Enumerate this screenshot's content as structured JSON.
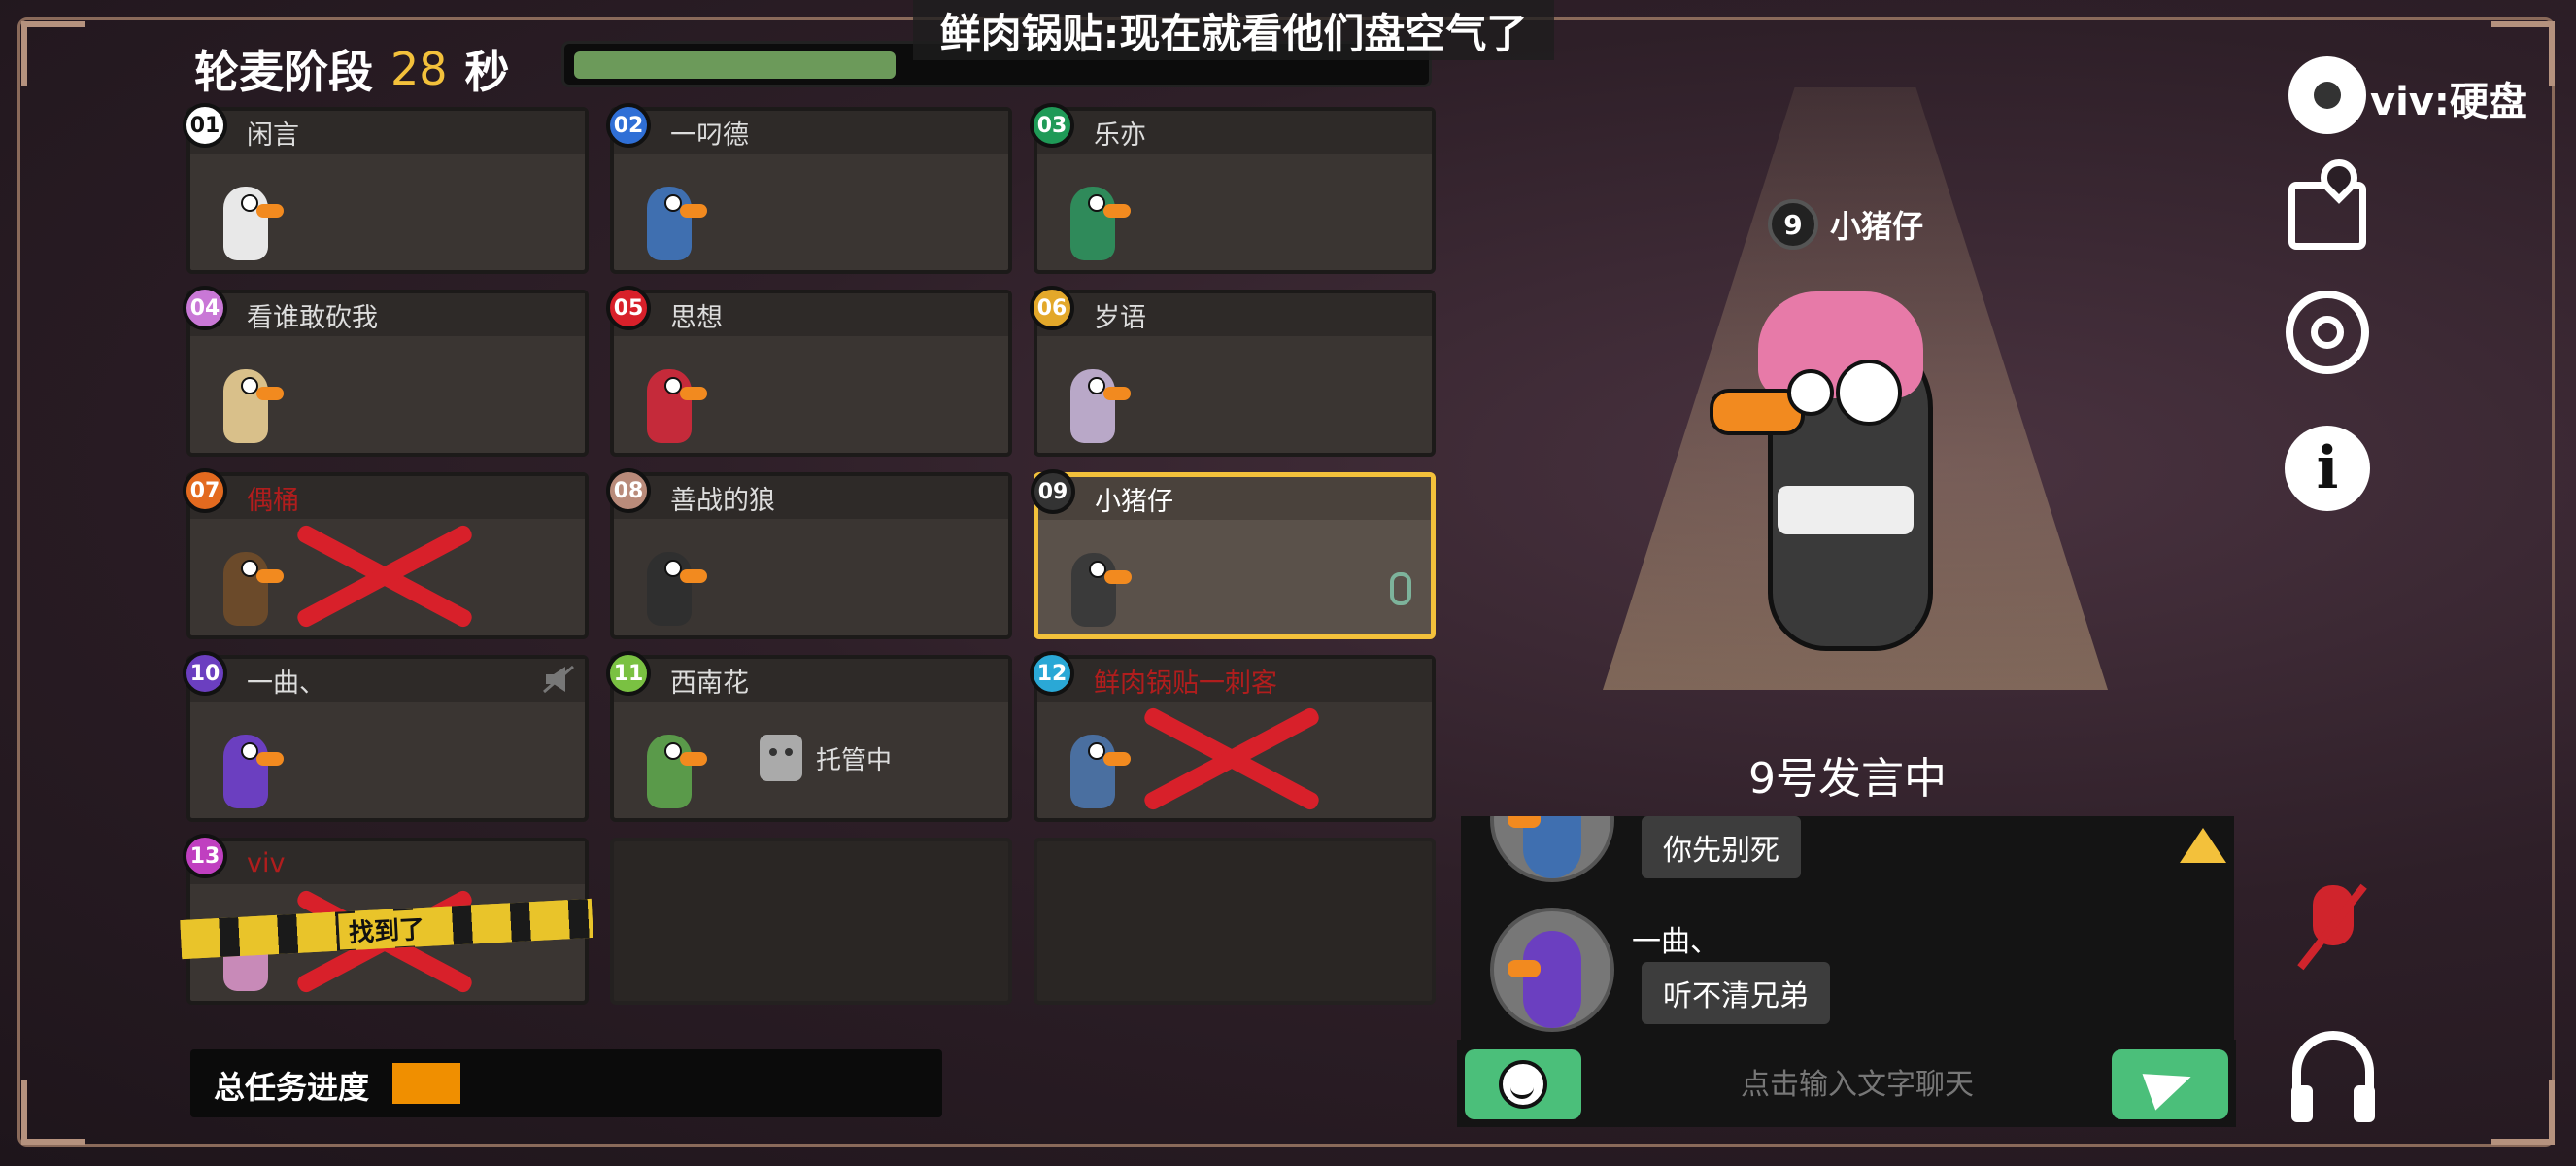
{
  "header": {
    "phase_label": "轮麦阶段",
    "seconds": "28",
    "seconds_unit": "秒",
    "timer_fraction": 0.38,
    "broadcast": "鲜肉锅贴:现在就看他们盘空气了"
  },
  "players": [
    {
      "num": "01",
      "name": "闲言",
      "badge_color": "#ffffff",
      "goose_color": "#e8e8e8",
      "status": "alive"
    },
    {
      "num": "02",
      "name": "一叼德",
      "badge_color": "#2f6fd6",
      "goose_color": "#3f6fb0",
      "status": "alive"
    },
    {
      "num": "03",
      "name": "乐亦",
      "badge_color": "#1f9a57",
      "goose_color": "#2f8a5a",
      "status": "alive"
    },
    {
      "num": "04",
      "name": "看谁敢砍我",
      "badge_color": "#c978d6",
      "goose_color": "#d9c08a",
      "status": "alive"
    },
    {
      "num": "05",
      "name": "思想",
      "badge_color": "#d8202a",
      "goose_color": "#c52a3a",
      "status": "alive"
    },
    {
      "num": "06",
      "name": "岁语",
      "badge_color": "#e3a82a",
      "goose_color": "#b9a8c8",
      "status": "alive"
    },
    {
      "num": "07",
      "name": "偶桶",
      "badge_color": "#e36a1f",
      "goose_color": "#6b4a2a",
      "status": "dead"
    },
    {
      "num": "08",
      "name": "善战的狼",
      "badge_color": "#b98b7a",
      "goose_color": "#2f2f2f",
      "status": "alive"
    },
    {
      "num": "09",
      "name": "小猪仔",
      "badge_color": "#333333",
      "goose_color": "#3a3a3a",
      "status": "speaking"
    },
    {
      "num": "10",
      "name": "一曲、",
      "badge_color": "#6b3fc0",
      "goose_color": "#6b3fc0",
      "status": "muted"
    },
    {
      "num": "11",
      "name": "西南花",
      "badge_color": "#7ac142",
      "goose_color": "#5a9a4a",
      "status": "trustee",
      "trustee_label": "托管中"
    },
    {
      "num": "12",
      "name": "鲜肉锅贴一刺客",
      "badge_color": "#2aa8d6",
      "goose_color": "#4a6fa0",
      "status": "dead"
    },
    {
      "num": "13",
      "name": "viv",
      "badge_color": "#c03fc0",
      "goose_color": "#c88ab8",
      "status": "found",
      "found_label": "找到了"
    }
  ],
  "task_progress": {
    "label": "总任务进度",
    "fraction": 0.13
  },
  "speaker": {
    "num": "9",
    "name": "小猪仔",
    "speaking_text": "9号发言中"
  },
  "chat": {
    "messages": [
      {
        "sender": "",
        "text": "你先别死"
      },
      {
        "sender": "一曲、",
        "text": "听不清兄弟"
      }
    ],
    "placeholder": "点击输入文字聊天"
  },
  "settings": {
    "label": "viv:硬盘"
  },
  "icons": [
    "gear-icon",
    "map-icon",
    "target-icon",
    "info-icon",
    "mic-off-icon",
    "headset-icon",
    "emoji-icon",
    "send-icon"
  ],
  "colors": {
    "accent_yellow": "#f3c13b",
    "progress_orange": "#f08f00",
    "button_green": "#4bbf7a",
    "dead_red": "#d8202a"
  }
}
